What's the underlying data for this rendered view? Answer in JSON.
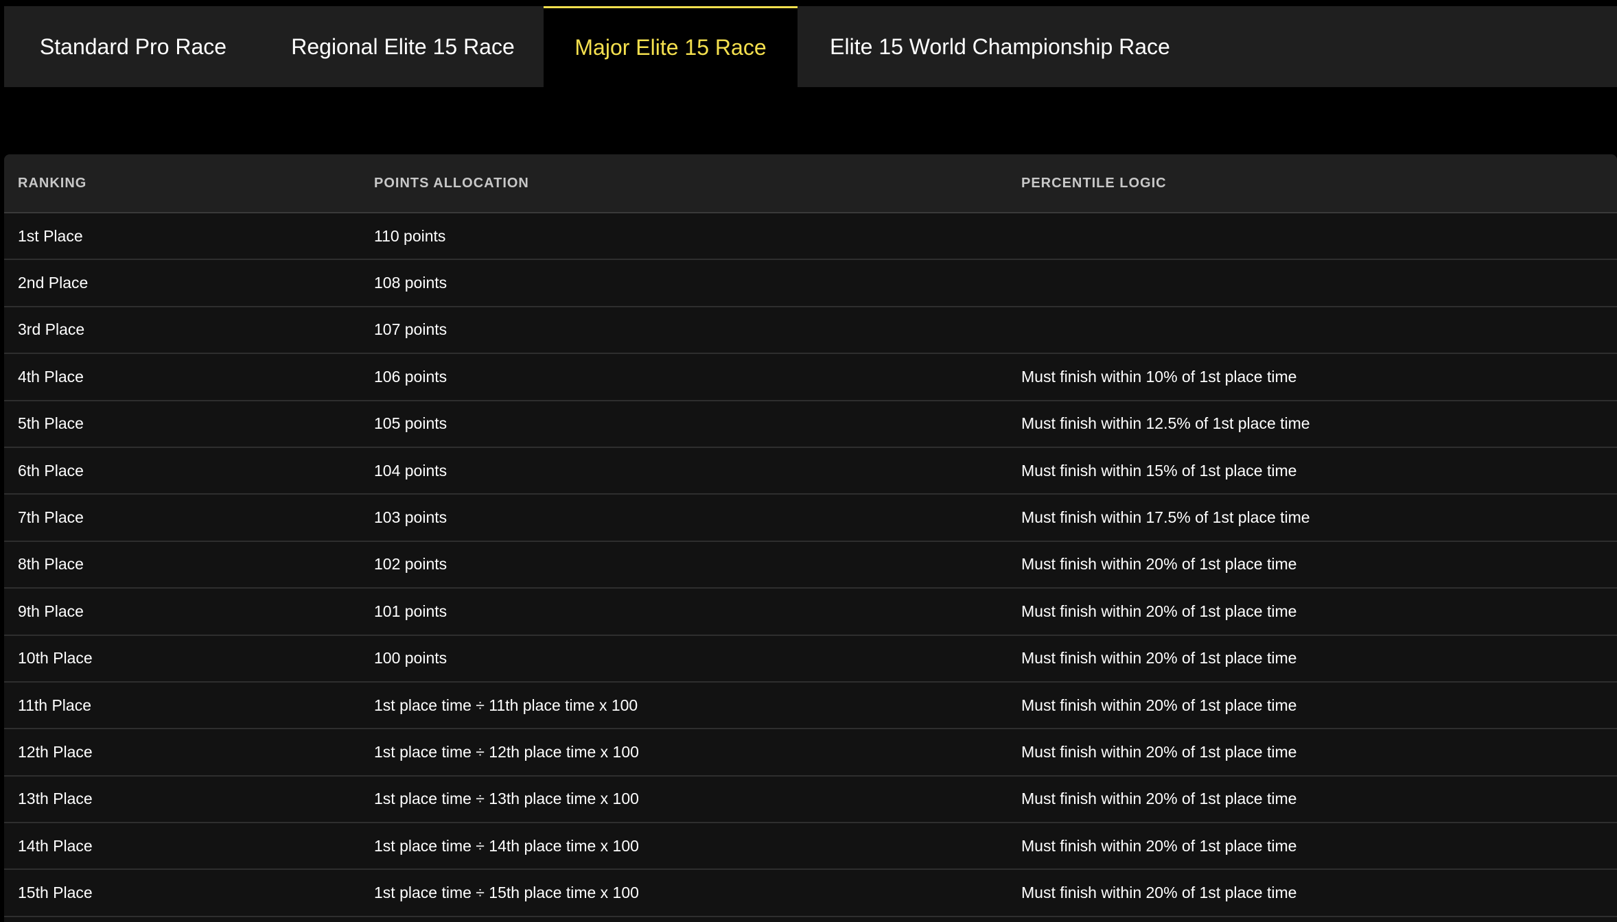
{
  "tabs": [
    {
      "label": "Standard Pro Race",
      "active": false
    },
    {
      "label": "Regional Elite 15 Race",
      "active": false
    },
    {
      "label": "Major Elite 15 Race",
      "active": true
    },
    {
      "label": "Elite 15 World Championship Race",
      "active": false
    }
  ],
  "colors": {
    "accent": "#f5e04e",
    "background": "#000000",
    "tabbar": "#1f1f1f",
    "table": "#121212"
  },
  "table": {
    "headers": [
      "RANKING",
      "POINTS ALLOCATION",
      "PERCENTILE LOGIC"
    ],
    "rows": [
      [
        "1st Place",
        "110 points",
        ""
      ],
      [
        "2nd Place",
        "108 points",
        ""
      ],
      [
        "3rd Place",
        "107 points",
        ""
      ],
      [
        "4th Place",
        "106 points",
        "Must finish within 10% of 1st place time"
      ],
      [
        "5th Place",
        "105 points",
        "Must finish within 12.5% of 1st place time"
      ],
      [
        "6th Place",
        "104 points",
        "Must finish within 15% of 1st place time"
      ],
      [
        "7th Place",
        "103 points",
        "Must finish within 17.5% of 1st place time"
      ],
      [
        "8th Place",
        "102 points",
        "Must finish within 20% of 1st place time"
      ],
      [
        "9th Place",
        "101 points",
        "Must finish within 20% of 1st place time"
      ],
      [
        "10th Place",
        "100 points",
        "Must finish within 20% of 1st place time"
      ],
      [
        "11th Place",
        "1st place time ÷ 11th place time x 100",
        "Must finish within 20% of 1st place time"
      ],
      [
        "12th Place",
        "1st place time ÷ 12th place time x 100",
        "Must finish within 20% of 1st place time"
      ],
      [
        "13th Place",
        "1st place time ÷ 13th place time x 100",
        "Must finish within 20% of 1st place time"
      ],
      [
        "14th Place",
        "1st place time ÷ 14th place time x 100",
        "Must finish within 20% of 1st place time"
      ],
      [
        "15th Place",
        "1st place time ÷ 15th place time x 100",
        "Must finish within 20% of 1st place time"
      ]
    ]
  }
}
